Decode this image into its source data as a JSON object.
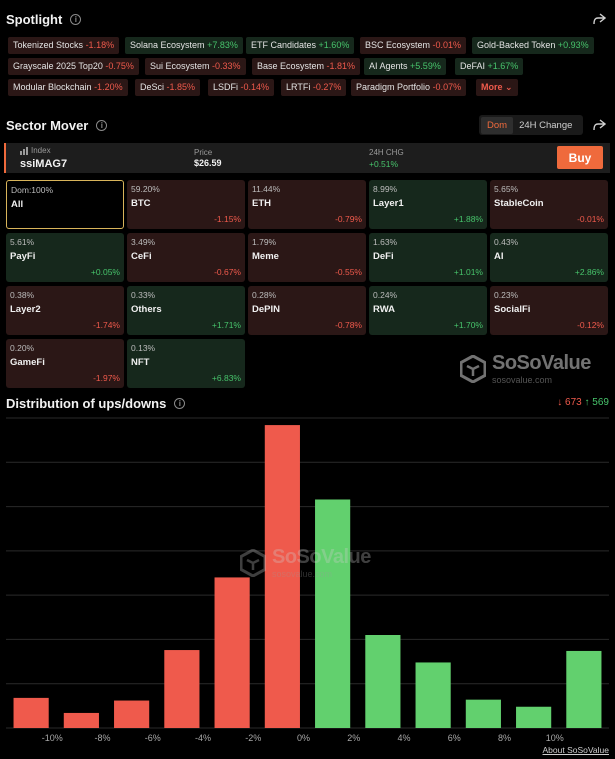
{
  "spotlight": {
    "title": "Spotlight",
    "tags": [
      {
        "name": "Tokenized Stocks",
        "change": "-1.18%",
        "dir": "down"
      },
      {
        "name": "Solana Ecosystem",
        "change": "+7.83%",
        "dir": "up"
      },
      {
        "name": "ETF Candidates",
        "change": "+1.60%",
        "dir": "up"
      },
      {
        "name": "BSC Ecosystem",
        "change": "-0.01%",
        "dir": "down"
      },
      {
        "name": "Gold-Backed Token",
        "change": "+0.93%",
        "dir": "up"
      },
      {
        "name": "Grayscale 2025 Top20",
        "change": "-0.75%",
        "dir": "down"
      },
      {
        "name": "Sui Ecosystem",
        "change": "-0.33%",
        "dir": "down"
      },
      {
        "name": "Base Ecosystem",
        "change": "-1.81%",
        "dir": "down"
      },
      {
        "name": "AI Agents",
        "change": "+5.59%",
        "dir": "up"
      },
      {
        "name": "DeFAI",
        "change": "+1.67%",
        "dir": "up"
      },
      {
        "name": "Modular Blockchain",
        "change": "-1.20%",
        "dir": "down"
      },
      {
        "name": "DeSci",
        "change": "-1.85%",
        "dir": "down"
      },
      {
        "name": "LSDFi",
        "change": "-0.14%",
        "dir": "down"
      },
      {
        "name": "LRTFi",
        "change": "-0.27%",
        "dir": "down"
      },
      {
        "name": "Paradigm Portfolio",
        "change": "-0.07%",
        "dir": "down"
      }
    ],
    "more_label": "More"
  },
  "sector": {
    "title": "Sector Mover",
    "toggle": {
      "dom": "Dom",
      "change": "24H Change"
    },
    "index": {
      "label": "Index",
      "name": "ssiMAG7",
      "price_label": "Price",
      "price": "$26.59",
      "chg_label": "24H CHG",
      "chg": "+0.51%",
      "buy_label": "Buy"
    },
    "tiles": [
      {
        "pct": "Dom:100%",
        "name": "All",
        "change": "",
        "dir": "sel"
      },
      {
        "pct": "59.20%",
        "name": "BTC",
        "change": "-1.15%",
        "dir": "down"
      },
      {
        "pct": "11.44%",
        "name": "ETH",
        "change": "-0.79%",
        "dir": "down"
      },
      {
        "pct": "8.99%",
        "name": "Layer1",
        "change": "+1.88%",
        "dir": "up"
      },
      {
        "pct": "5.65%",
        "name": "StableCoin",
        "change": "-0.01%",
        "dir": "down"
      },
      {
        "pct": "5.61%",
        "name": "PayFi",
        "change": "+0.05%",
        "dir": "up"
      },
      {
        "pct": "3.49%",
        "name": "CeFi",
        "change": "-0.67%",
        "dir": "down"
      },
      {
        "pct": "1.79%",
        "name": "Meme",
        "change": "-0.55%",
        "dir": "down"
      },
      {
        "pct": "1.63%",
        "name": "DeFi",
        "change": "+1.01%",
        "dir": "up"
      },
      {
        "pct": "0.43%",
        "name": "AI",
        "change": "+2.86%",
        "dir": "up"
      },
      {
        "pct": "0.38%",
        "name": "Layer2",
        "change": "-1.74%",
        "dir": "down"
      },
      {
        "pct": "0.33%",
        "name": "Others",
        "change": "+1.71%",
        "dir": "up"
      },
      {
        "pct": "0.28%",
        "name": "DePIN",
        "change": "-0.78%",
        "dir": "down"
      },
      {
        "pct": "0.24%",
        "name": "RWA",
        "change": "+1.70%",
        "dir": "up"
      },
      {
        "pct": "0.23%",
        "name": "SocialFi",
        "change": "-0.12%",
        "dir": "down"
      },
      {
        "pct": "0.20%",
        "name": "GameFi",
        "change": "-1.97%",
        "dir": "down"
      },
      {
        "pct": "0.13%",
        "name": "NFT",
        "change": "+6.83%",
        "dir": "up"
      }
    ],
    "logo_text": "SoSoValue",
    "logo_sub": "sosovalue.com"
  },
  "distribution": {
    "title": "Distribution of ups/downs",
    "down_count": "↓ 673",
    "up_count": "↑ 569",
    "about_label": "About SoSoValue"
  },
  "chart_data": {
    "type": "bar",
    "categories": [
      "< -10%",
      "-10% ~ -8%",
      "-8% ~ -6%",
      "-6% ~ -4%",
      "-4% ~ -2%",
      "-2% ~ 0%",
      "0% ~ 2%",
      "2% ~ 4%",
      "4% ~ 6%",
      "6% ~ 8%",
      "8% ~ 10%",
      "> 10%"
    ],
    "values": [
      34,
      17,
      31,
      88,
      170,
      342,
      258,
      105,
      74,
      32,
      24,
      87
    ],
    "tick_labels": [
      "-10%",
      "-8%",
      "-6%",
      "-4%",
      "-2%",
      "0%",
      "2%",
      "4%",
      "6%",
      "8%",
      "10%"
    ],
    "title": "",
    "xlabel": "",
    "ylabel": "",
    "ylim": [
      0,
      350
    ],
    "grid": true,
    "colors": {
      "down": "#ef5a4c",
      "up": "#62d06e",
      "grid": "#2a2a2a"
    }
  }
}
